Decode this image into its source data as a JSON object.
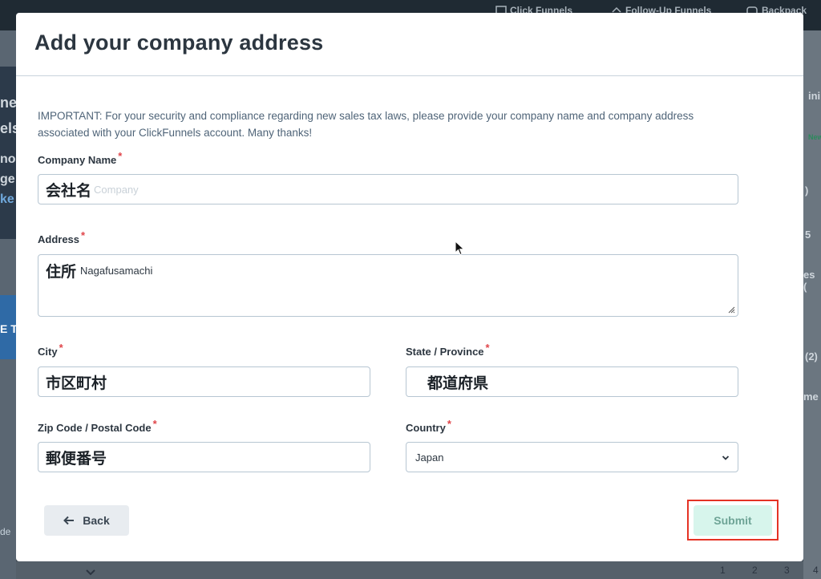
{
  "background": {
    "nav": [
      "Click Funnels",
      "Follow-Up Funnels",
      "Backpack"
    ],
    "left_fragments": [
      "ne",
      "els",
      "nor",
      "ge",
      "ke",
      "E T",
      "de"
    ],
    "right_fragments": [
      "ini",
      "New",
      ")",
      "5",
      "es (",
      "(2)",
      "me"
    ],
    "pages": [
      "1",
      "2",
      "3",
      "4"
    ]
  },
  "modal": {
    "title": "Add your company address",
    "notice": "IMPORTANT: For your security and compliance regarding new sales tax laws, please provide your company name and company address associated with your ClickFunnels account. Many thanks!",
    "required_mark": "*",
    "company": {
      "label": "Company Name",
      "annotation": "会社名",
      "placeholder": "Company"
    },
    "address": {
      "label": "Address",
      "annotation": "住所",
      "value": "Nagafusamachi"
    },
    "city": {
      "label": "City",
      "annotation": "市区町村"
    },
    "state": {
      "label": "State / Province",
      "annotation": "都道府県"
    },
    "zip": {
      "label": "Zip Code / Postal Code",
      "annotation": "郵便番号"
    },
    "country": {
      "label": "Country",
      "value": "Japan"
    },
    "back_label": "Back",
    "submit_label": "Submit"
  },
  "colors": {
    "required": "#e0454a",
    "submit_bg": "#d7f5ec",
    "highlight": "#e53325"
  }
}
